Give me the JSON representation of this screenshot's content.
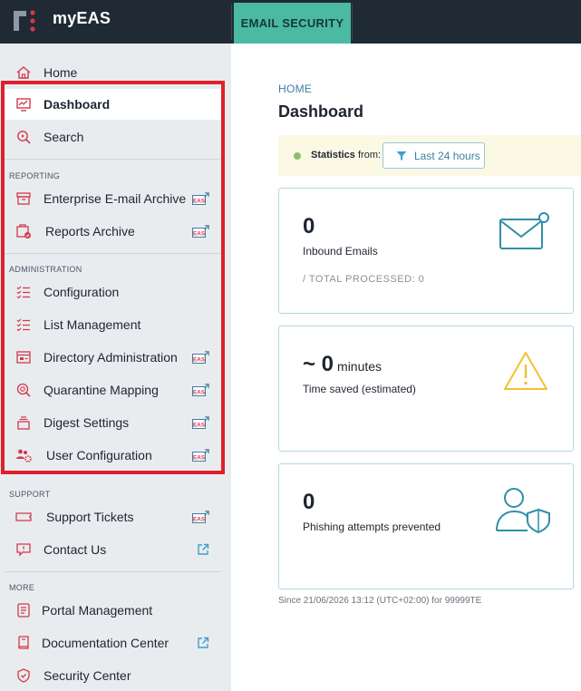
{
  "app": {
    "name": "myEAS",
    "product_tab": "EMAIL SECURITY"
  },
  "sidebar": {
    "top_items": [
      {
        "label": "Home"
      },
      {
        "label": "Dashboard",
        "active": true
      },
      {
        "label": "Search"
      }
    ],
    "sections": [
      {
        "title": "REPORTING",
        "items": [
          {
            "label": "Enterprise E-mail Archive",
            "badge": "EAS"
          },
          {
            "label": "Reports Archive",
            "badge": "EAS"
          }
        ]
      },
      {
        "title": "ADMINISTRATION",
        "items": [
          {
            "label": "Configuration"
          },
          {
            "label": "List Management"
          },
          {
            "label": "Directory Administration",
            "badge": "EAS"
          },
          {
            "label": "Quarantine Mapping",
            "badge": "EAS"
          },
          {
            "label": "Digest Settings",
            "badge": "EAS"
          },
          {
            "label": "User Configuration",
            "badge": "EAS"
          }
        ]
      },
      {
        "title": "SUPPORT",
        "items": [
          {
            "label": "Support Tickets",
            "badge": "EAS"
          },
          {
            "label": "Contact Us",
            "icon": "external-link-icon"
          }
        ]
      },
      {
        "title": "MORE",
        "items": [
          {
            "label": "Portal Management"
          },
          {
            "label": "Documentation Center",
            "icon": "external-link-icon"
          },
          {
            "label": "Security Center"
          }
        ]
      }
    ]
  },
  "main": {
    "breadcrumb": "HOME",
    "title": "Dashboard",
    "stats": {
      "label_bold": "Statistics",
      "label_rest": " from:",
      "filter_label": "Last 24 hours"
    },
    "cards": [
      {
        "value": "0",
        "label": "Inbound Emails",
        "sub": "/ TOTAL PROCESSED: 0",
        "icon": "envelope-icon"
      },
      {
        "value": "~ 0",
        "unit": "minutes",
        "label": "Time saved (estimated)",
        "icon": "warning-icon"
      },
      {
        "value": "0",
        "label": "Phishing attempts prevented",
        "icon": "user-shield-icon"
      }
    ],
    "since": "Since 21/06/2026 13:12 (UTC+02:00) for 99999TE"
  },
  "colors": {
    "brand_red": "#d23a4a",
    "accent_teal": "#4cb9a4",
    "link_blue": "#3e7fa0",
    "highlight_red": "#e0202c",
    "warning_yellow": "#f2c12e"
  }
}
